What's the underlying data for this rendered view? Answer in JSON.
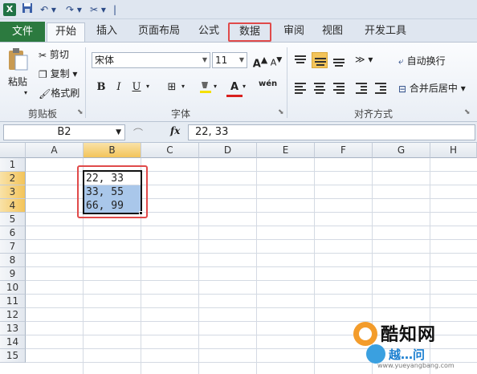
{
  "tabs": {
    "file": "文件",
    "items": [
      "开始",
      "插入",
      "页面布局",
      "公式",
      "数据",
      "审阅",
      "视图",
      "开发工具"
    ]
  },
  "ribbon": {
    "clipboard": {
      "paste": "粘贴",
      "cut": "剪切",
      "copy": "复制",
      "format_painter": "格式刷",
      "group": "剪贴板"
    },
    "font": {
      "name": "宋体",
      "size": "11",
      "grow": "A",
      "shrink": "A",
      "bold": "B",
      "italic": "I",
      "underline": "U",
      "font_color": "A",
      "wen": "wén",
      "group": "字体"
    },
    "alignment": {
      "wrap_text": "自动换行",
      "merge_center": "合并后居中",
      "group": "对齐方式"
    }
  },
  "formula_bar": {
    "name_box": "B2",
    "fx": "fx",
    "content": "22, 33"
  },
  "grid": {
    "columns": [
      "A",
      "B",
      "C",
      "D",
      "E",
      "F",
      "G",
      "H"
    ],
    "rows": [
      "1",
      "2",
      "3",
      "4",
      "5",
      "6",
      "7",
      "8",
      "9",
      "10",
      "11",
      "12",
      "13",
      "14",
      "15"
    ],
    "cells": {
      "B2": "22, 33",
      "B3": "33, 55",
      "B4": "66, 99"
    }
  },
  "watermark": {
    "title": "酷知网",
    "subtitle": "越…问",
    "url": "www.yueyangbang.com"
  },
  "colors": {
    "file_tab": "#2c7a3f",
    "highlight": "#e04a4a",
    "selection": "#a9c7ea",
    "header_active": "#f3c45a"
  }
}
